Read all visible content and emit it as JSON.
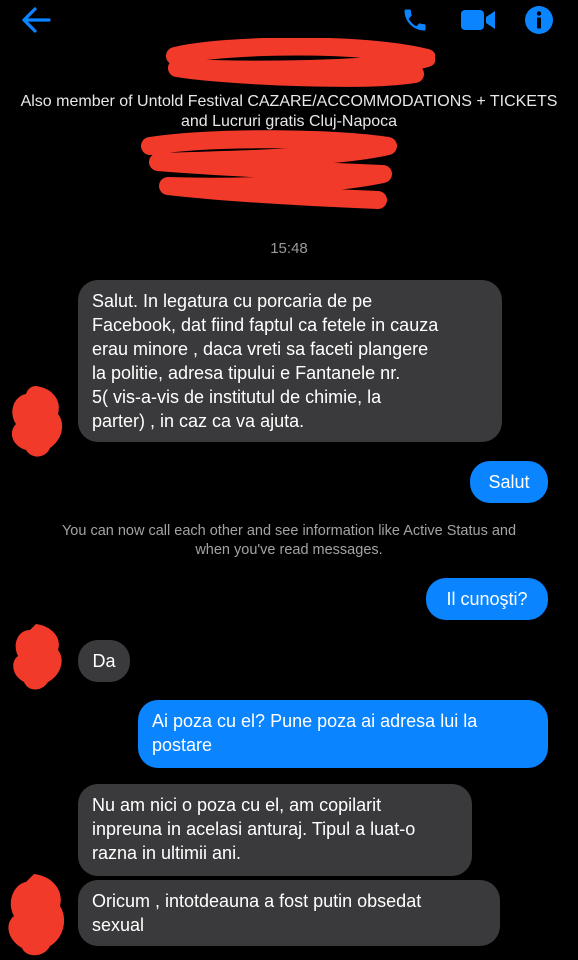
{
  "header": {
    "description": "Also member of Untold Festival CAZARE/ACCOMMODATIONS + TICKETS and Lucruri gratis Cluj-Napoca"
  },
  "icons": {
    "back": "arrow-left-icon",
    "call": "phone-icon",
    "video": "video-camera-icon",
    "info": "info-icon",
    "accent": "#0a84ff"
  },
  "conversation": {
    "timestamp": "15:48",
    "notice": "You can now call each other and see information like Active Status and when you've read messages.",
    "messages": [
      {
        "sender": "them",
        "text": "Salut. In legatura cu porcaria de pe\nFacebook, dat fiind faptul ca fetele in cauza\nerau minore , daca vreti sa faceti plangere\nla politie, adresa tipului e Fantanele nr.\n5( vis-a-vis de institutul de chimie, la\nparter) , in caz ca va ajuta."
      },
      {
        "sender": "me",
        "text": "Salut"
      },
      {
        "sender": "me",
        "text": "Il cunoşti?"
      },
      {
        "sender": "them",
        "text": "Da"
      },
      {
        "sender": "me",
        "text": "Ai poza cu el? Pune poza ai adresa lui la\npostare"
      },
      {
        "sender": "them",
        "text": "Nu am nici o poza cu el, am copilarit\ninpreuna in acelasi anturaj. Tipul a luat-o\nrazna in ultimii ani."
      },
      {
        "sender": "them",
        "text": "Oricum , intotdeauna a fost putin obsedat\nsexual"
      }
    ]
  },
  "colors": {
    "incoming_bubble": "#3a3a3c",
    "outgoing_bubble": "#0a84ff",
    "redaction": "#f23a2a"
  }
}
